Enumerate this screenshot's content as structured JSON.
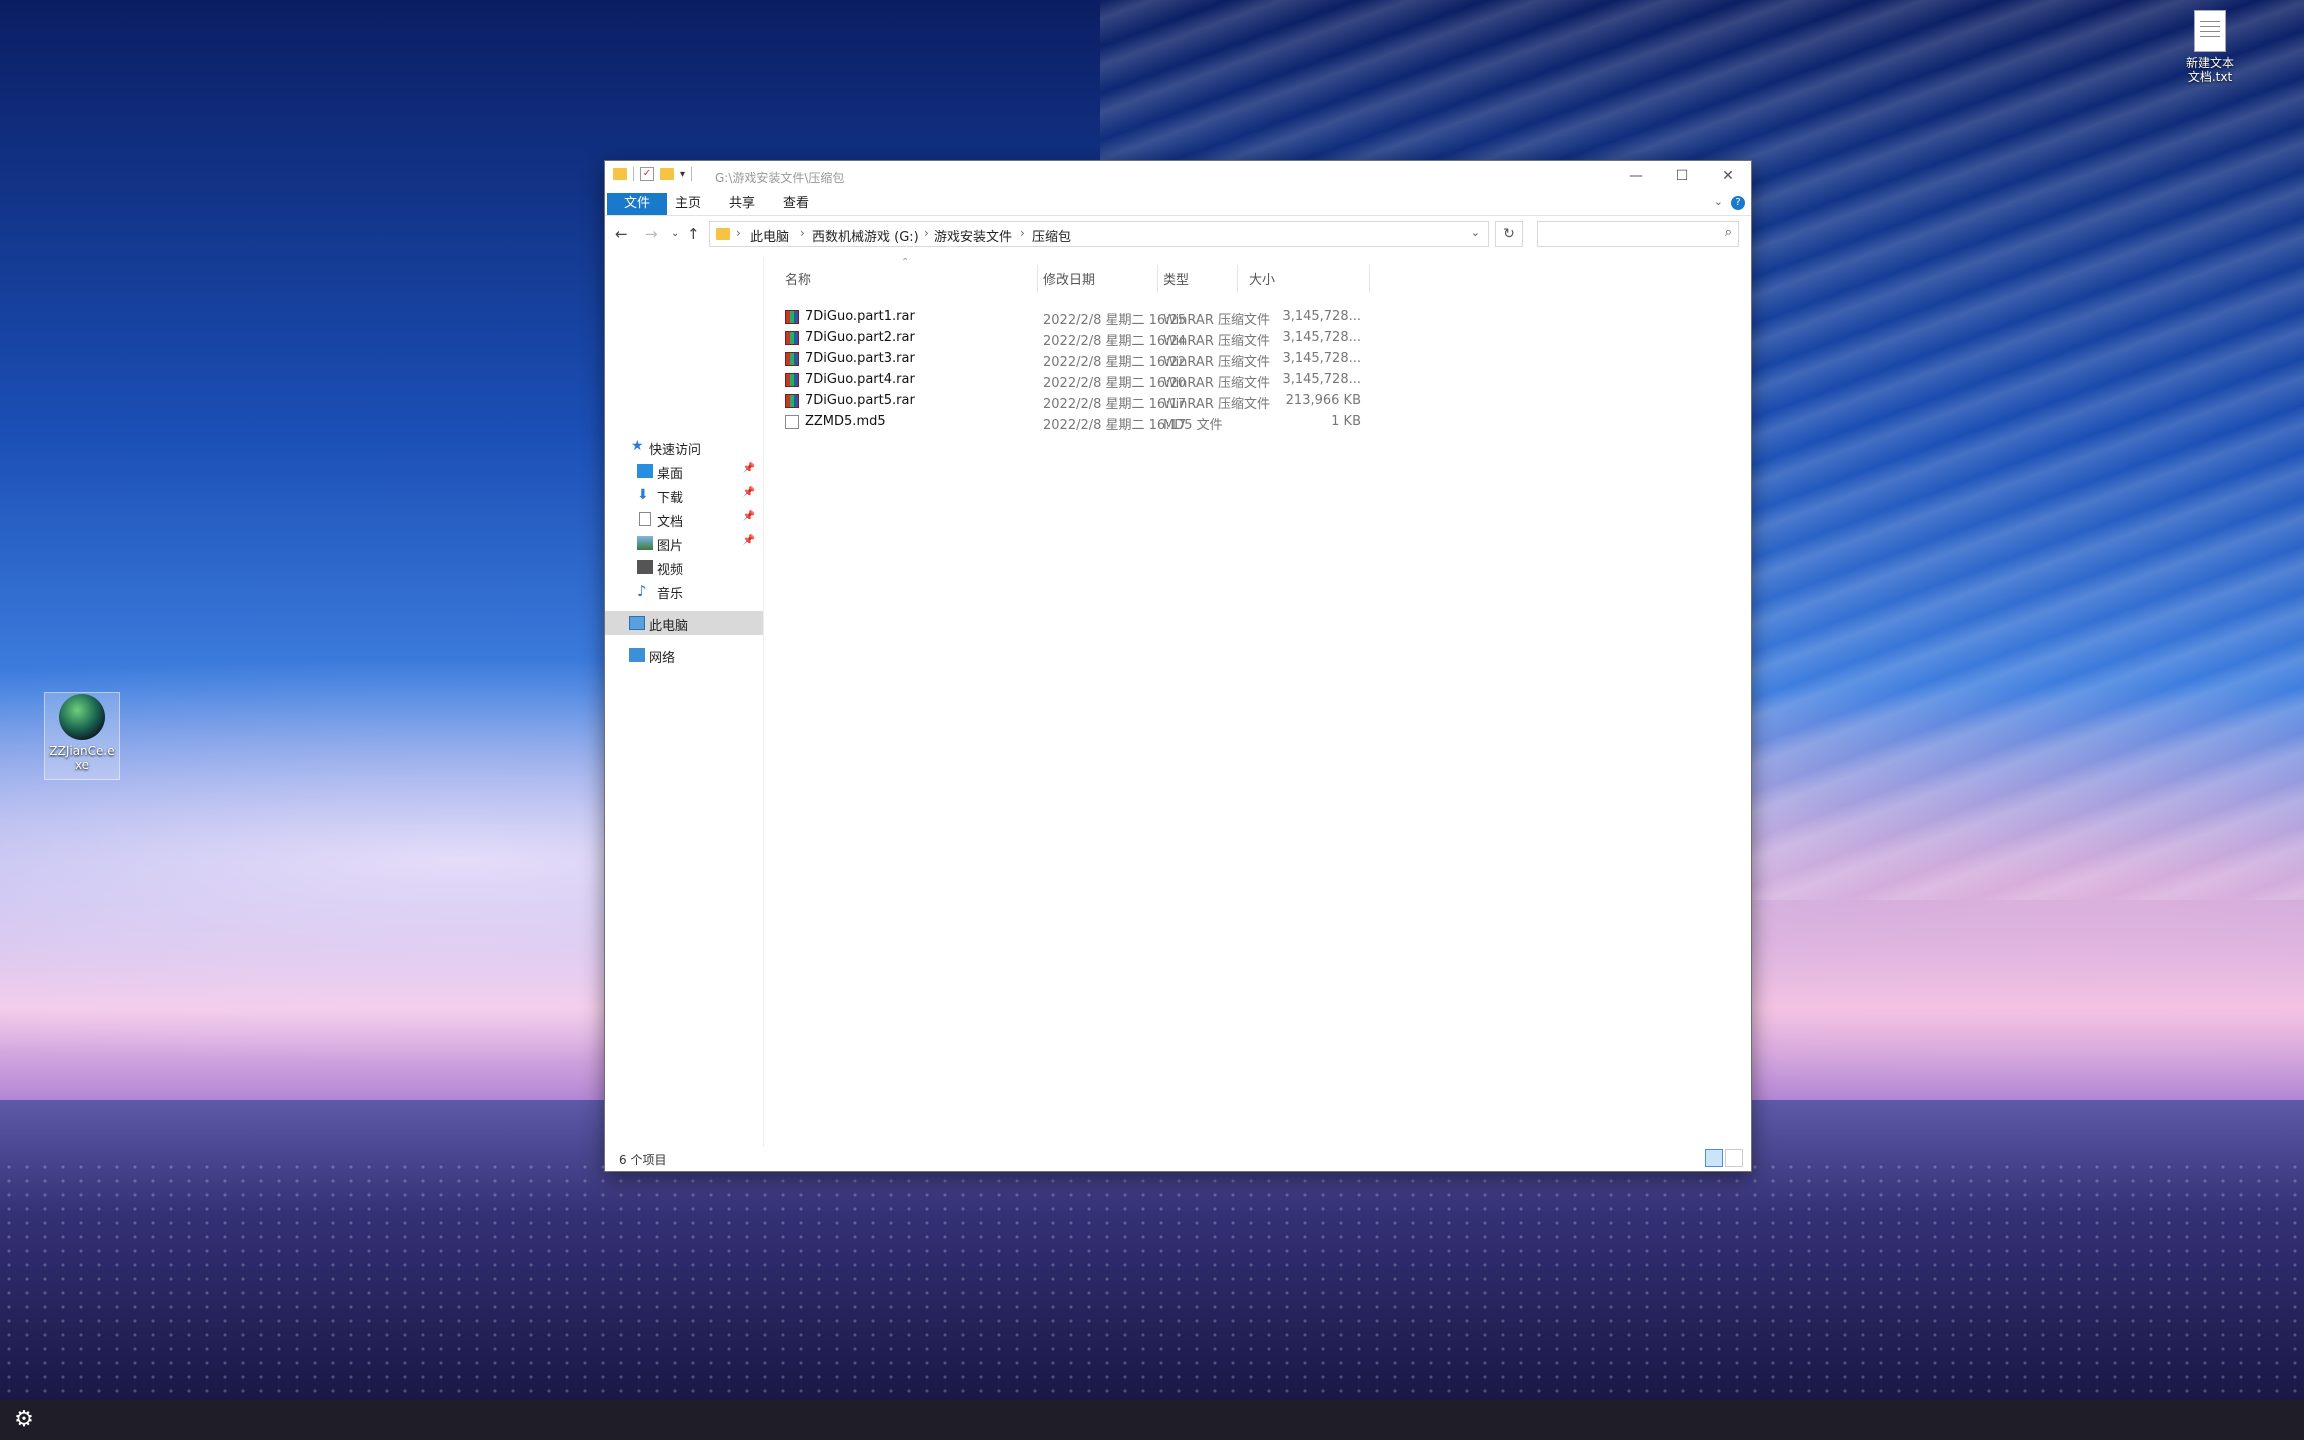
{
  "desktop": {
    "icons": [
      {
        "label": "ZZJianCe.exe",
        "icon": "exe-icon"
      },
      {
        "label": "新建文本文档.txt",
        "icon": "text-file-icon"
      }
    ]
  },
  "window": {
    "title": "G:\\游戏安装文件\\压缩包",
    "ribbon_tabs": [
      "文件",
      "主页",
      "共享",
      "查看"
    ],
    "breadcrumb": [
      "此电脑",
      "西数机械游戏 (G:)",
      "游戏安装文件",
      "压缩包"
    ],
    "search_placeholder": "",
    "nav_pane": {
      "quick_access": "快速访问",
      "items": [
        "桌面",
        "下载",
        "文档",
        "图片",
        "视频",
        "音乐"
      ],
      "this_pc": "此电脑",
      "network": "网络"
    },
    "columns": [
      "名称",
      "修改日期",
      "类型",
      "大小"
    ],
    "files": [
      {
        "name": "7DiGuo.part1.rar",
        "date": "2022/2/8 星期二 16:25",
        "type": "WinRAR 压缩文件",
        "size": "3,145,728..."
      },
      {
        "name": "7DiGuo.part2.rar",
        "date": "2022/2/8 星期二 16:24",
        "type": "WinRAR 压缩文件",
        "size": "3,145,728..."
      },
      {
        "name": "7DiGuo.part3.rar",
        "date": "2022/2/8 星期二 16:22",
        "type": "WinRAR 压缩文件",
        "size": "3,145,728..."
      },
      {
        "name": "7DiGuo.part4.rar",
        "date": "2022/2/8 星期二 16:20",
        "type": "WinRAR 压缩文件",
        "size": "3,145,728..."
      },
      {
        "name": "7DiGuo.part5.rar",
        "date": "2022/2/8 星期二 16:17",
        "type": "WinRAR 压缩文件",
        "size": "213,966 KB"
      },
      {
        "name": "ZZMD5.md5",
        "date": "2022/2/8 星期二 16:17",
        "type": "MD5 文件",
        "size": "1 KB"
      }
    ],
    "status": "6 个项目"
  },
  "colors": {
    "accent": "#1979ca",
    "selection": "#d9d9d9"
  }
}
